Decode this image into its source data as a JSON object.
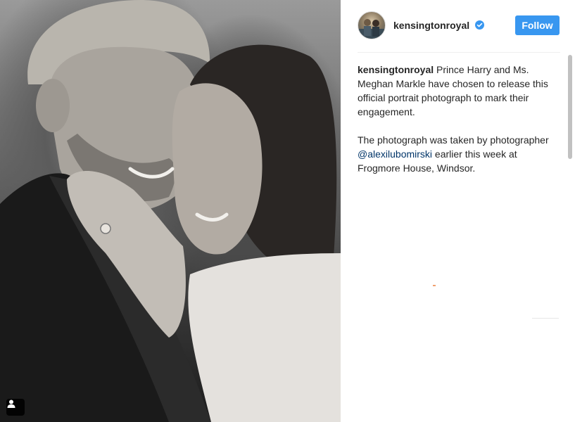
{
  "post": {
    "image_alt": "Black and white portrait of a couple embracing",
    "tag_icon": "user-tag-icon"
  },
  "header": {
    "username": "kensingtonroyal",
    "verified_icon": "verified-badge-icon",
    "follow_label": "Follow",
    "accent_color": "#3897f0"
  },
  "caption": {
    "username": "kensingtonroyal",
    "text_1": " Prince Harry and Ms. Meghan Markle have chosen to release this official portrait photograph to mark their engagement.",
    "text_2a": "The photograph was taken by photographer ",
    "mention": "@alexilubomirski",
    "text_2b": " earlier this week at Frogmore House, Windsor."
  }
}
